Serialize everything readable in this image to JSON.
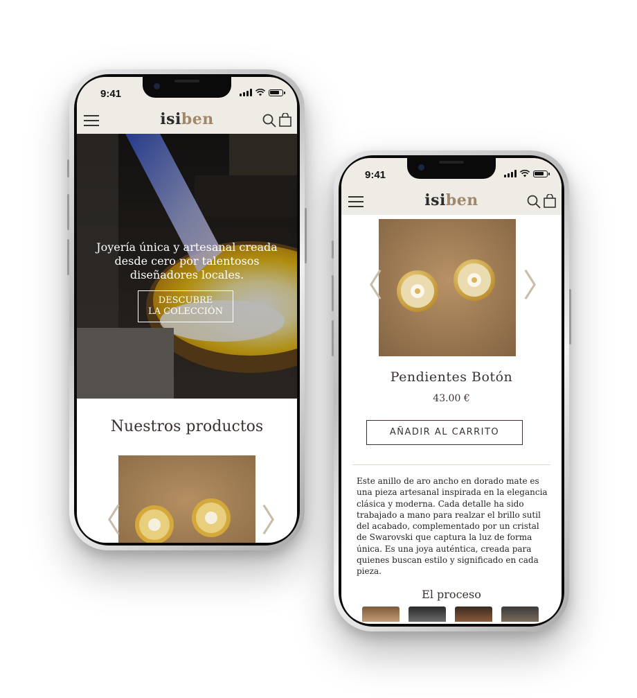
{
  "status_bar": {
    "time": "9:41"
  },
  "brand": {
    "logo_part1": "isi",
    "logo_part2": "ben",
    "color_dark": "#2b2b2b",
    "color_accent": "#a2886a",
    "nav_bg": "#efebe5"
  },
  "icons": {
    "menu": "hamburger-icon",
    "search": "search-icon",
    "cart": "shopping-bag-icon",
    "prev": "chevron-left-icon",
    "next": "chevron-right-icon"
  },
  "home": {
    "hero_text": "Joyería única y artesanal creada desde cero por talentosos diseñadores locales.",
    "cta_line1": "DESCUBRE",
    "cta_line2": "LA COLECCIÓN",
    "section_title": "Nuestros productos"
  },
  "product": {
    "name": "Pendientes Botón",
    "price": "43.00 €",
    "add_to_cart": "AÑADIR AL CARRITO",
    "description": "Este anillo de aro ancho en dorado mate es una pieza artesanal inspirada en la elegancia clásica y moderna. Cada detalle ha sido trabajado a mano para realzar el brillo sutil del acabado, complementado por un cristal de Swarovski que captura la luz de forma única. Es una joya auténtica, creada para quienes buscan estilo y significado en cada pieza.",
    "process_title": "El proceso"
  }
}
